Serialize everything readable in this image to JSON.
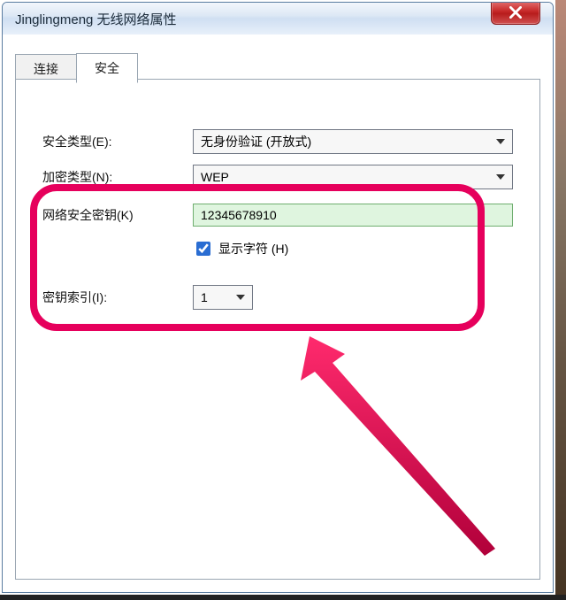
{
  "window": {
    "title": "Jinglingmeng 无线网络属性"
  },
  "tabs": {
    "connect": "连接",
    "security": "安全"
  },
  "fields": {
    "secType": {
      "label": "安全类型(E):",
      "value": "无身份验证 (开放式)"
    },
    "encType": {
      "label": "加密类型(N):",
      "value": "WEP"
    },
    "key": {
      "label": "网络安全密钥(K)",
      "value": "12345678910"
    },
    "show": {
      "label": "显示字符 (H)"
    },
    "index": {
      "label": "密钥索引(I):",
      "value": "1"
    }
  }
}
